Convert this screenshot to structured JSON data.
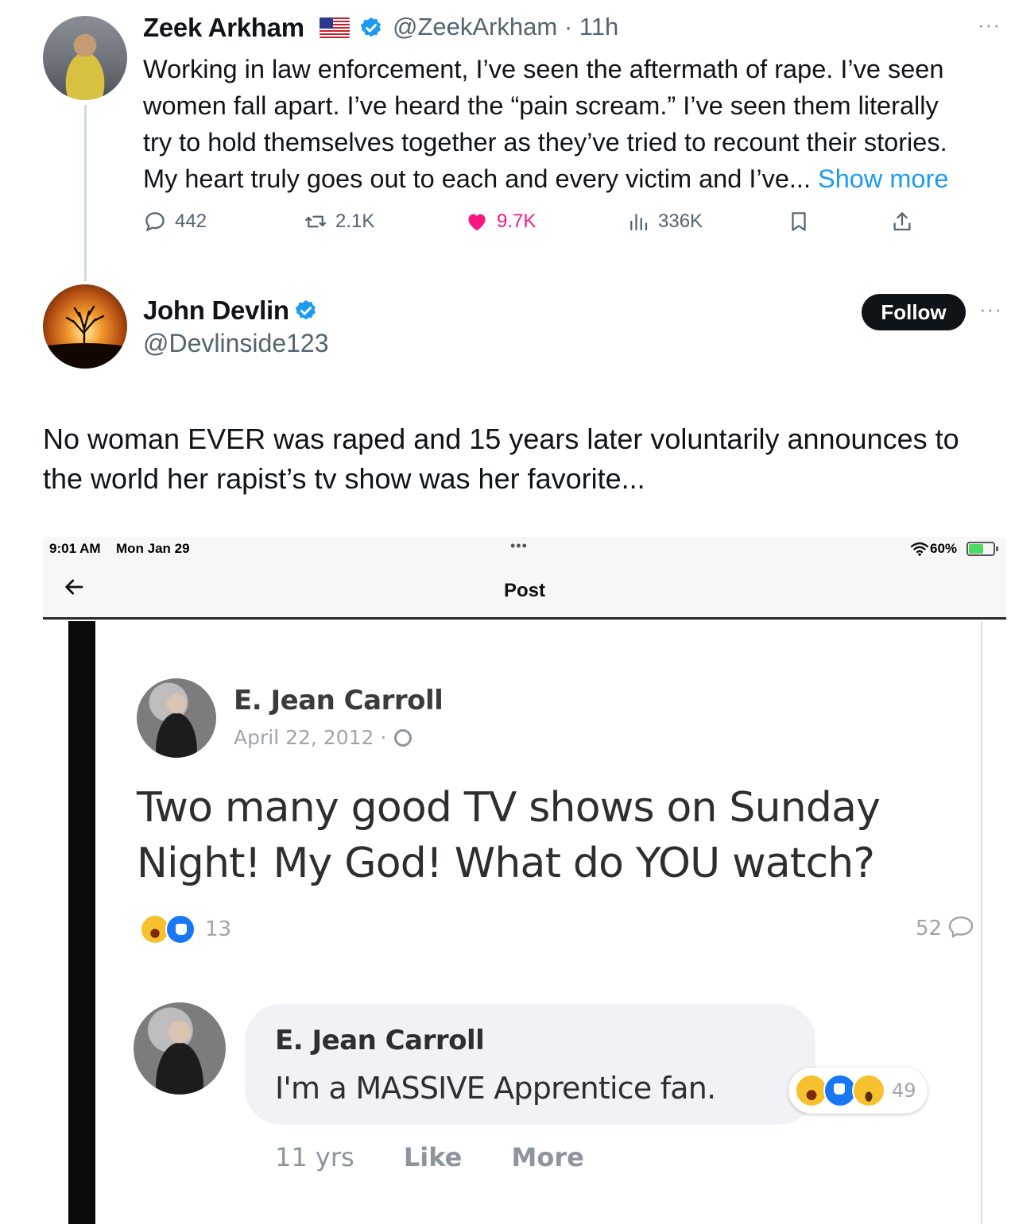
{
  "tweet1": {
    "name": "Zeek Arkham",
    "handle": "@ZeekArkham",
    "separator": "·",
    "time": "11h",
    "more": "···",
    "text_lines": [
      "Working in law enforcement, I’ve seen the aftermath of rape. I’ve seen",
      "women fall apart. I’ve heard the “pain scream.” I’ve seen them literally",
      "try to hold themselves together as they’ve tried to recount their stories.",
      "My heart truly goes out to each and every victim and I’ve... "
    ],
    "show_more": "Show more",
    "actions": {
      "replies": "442",
      "retweets": "2.1K",
      "likes": "9.7K",
      "views": "336K"
    }
  },
  "tweet2": {
    "name": "John Devlin",
    "handle": "@Devlinside123",
    "follow_label": "Follow",
    "more": "···",
    "text_lines": [
      "No woman EVER was raped and 15 years later voluntarily announces to",
      "the world her rapist’s tv show was her favorite..."
    ]
  },
  "embedded": {
    "status_bar": {
      "time": "9:01 AM",
      "date": "Mon Jan 29",
      "dots": "•••",
      "battery": "60%"
    },
    "nav_title": "Post",
    "fb_post": {
      "author": "E. Jean Carroll",
      "date": "April 22, 2012 ·",
      "text_lines": [
        "Two many good TV shows on Sunday",
        "Night! My God! What do YOU watch?"
      ],
      "reaction_count": "13",
      "comment_count": "52"
    },
    "fb_comment": {
      "author": "E. Jean Carroll",
      "text": "I'm a MASSIVE Apprentice fan.",
      "reaction_count": "49",
      "time": "11 yrs",
      "like": "Like",
      "more": "More"
    }
  },
  "colors": {
    "accent_blue": "#1d9bf0",
    "like_pink": "#f91880",
    "muted_text": "#536471",
    "facebook_blue": "#1877f2"
  }
}
